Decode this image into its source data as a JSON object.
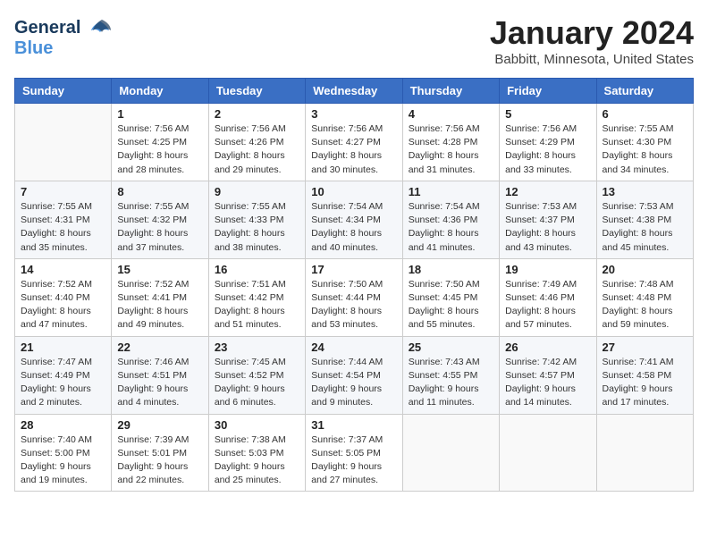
{
  "header": {
    "logo_general": "General",
    "logo_blue": "Blue",
    "month": "January 2024",
    "location": "Babbitt, Minnesota, United States"
  },
  "days_of_week": [
    "Sunday",
    "Monday",
    "Tuesday",
    "Wednesday",
    "Thursday",
    "Friday",
    "Saturday"
  ],
  "weeks": [
    [
      {
        "day": "",
        "sunrise": "",
        "sunset": "",
        "daylight": ""
      },
      {
        "day": "1",
        "sunrise": "Sunrise: 7:56 AM",
        "sunset": "Sunset: 4:25 PM",
        "daylight": "Daylight: 8 hours and 28 minutes."
      },
      {
        "day": "2",
        "sunrise": "Sunrise: 7:56 AM",
        "sunset": "Sunset: 4:26 PM",
        "daylight": "Daylight: 8 hours and 29 minutes."
      },
      {
        "day": "3",
        "sunrise": "Sunrise: 7:56 AM",
        "sunset": "Sunset: 4:27 PM",
        "daylight": "Daylight: 8 hours and 30 minutes."
      },
      {
        "day": "4",
        "sunrise": "Sunrise: 7:56 AM",
        "sunset": "Sunset: 4:28 PM",
        "daylight": "Daylight: 8 hours and 31 minutes."
      },
      {
        "day": "5",
        "sunrise": "Sunrise: 7:56 AM",
        "sunset": "Sunset: 4:29 PM",
        "daylight": "Daylight: 8 hours and 33 minutes."
      },
      {
        "day": "6",
        "sunrise": "Sunrise: 7:55 AM",
        "sunset": "Sunset: 4:30 PM",
        "daylight": "Daylight: 8 hours and 34 minutes."
      }
    ],
    [
      {
        "day": "7",
        "sunrise": "Sunrise: 7:55 AM",
        "sunset": "Sunset: 4:31 PM",
        "daylight": "Daylight: 8 hours and 35 minutes."
      },
      {
        "day": "8",
        "sunrise": "Sunrise: 7:55 AM",
        "sunset": "Sunset: 4:32 PM",
        "daylight": "Daylight: 8 hours and 37 minutes."
      },
      {
        "day": "9",
        "sunrise": "Sunrise: 7:55 AM",
        "sunset": "Sunset: 4:33 PM",
        "daylight": "Daylight: 8 hours and 38 minutes."
      },
      {
        "day": "10",
        "sunrise": "Sunrise: 7:54 AM",
        "sunset": "Sunset: 4:34 PM",
        "daylight": "Daylight: 8 hours and 40 minutes."
      },
      {
        "day": "11",
        "sunrise": "Sunrise: 7:54 AM",
        "sunset": "Sunset: 4:36 PM",
        "daylight": "Daylight: 8 hours and 41 minutes."
      },
      {
        "day": "12",
        "sunrise": "Sunrise: 7:53 AM",
        "sunset": "Sunset: 4:37 PM",
        "daylight": "Daylight: 8 hours and 43 minutes."
      },
      {
        "day": "13",
        "sunrise": "Sunrise: 7:53 AM",
        "sunset": "Sunset: 4:38 PM",
        "daylight": "Daylight: 8 hours and 45 minutes."
      }
    ],
    [
      {
        "day": "14",
        "sunrise": "Sunrise: 7:52 AM",
        "sunset": "Sunset: 4:40 PM",
        "daylight": "Daylight: 8 hours and 47 minutes."
      },
      {
        "day": "15",
        "sunrise": "Sunrise: 7:52 AM",
        "sunset": "Sunset: 4:41 PM",
        "daylight": "Daylight: 8 hours and 49 minutes."
      },
      {
        "day": "16",
        "sunrise": "Sunrise: 7:51 AM",
        "sunset": "Sunset: 4:42 PM",
        "daylight": "Daylight: 8 hours and 51 minutes."
      },
      {
        "day": "17",
        "sunrise": "Sunrise: 7:50 AM",
        "sunset": "Sunset: 4:44 PM",
        "daylight": "Daylight: 8 hours and 53 minutes."
      },
      {
        "day": "18",
        "sunrise": "Sunrise: 7:50 AM",
        "sunset": "Sunset: 4:45 PM",
        "daylight": "Daylight: 8 hours and 55 minutes."
      },
      {
        "day": "19",
        "sunrise": "Sunrise: 7:49 AM",
        "sunset": "Sunset: 4:46 PM",
        "daylight": "Daylight: 8 hours and 57 minutes."
      },
      {
        "day": "20",
        "sunrise": "Sunrise: 7:48 AM",
        "sunset": "Sunset: 4:48 PM",
        "daylight": "Daylight: 8 hours and 59 minutes."
      }
    ],
    [
      {
        "day": "21",
        "sunrise": "Sunrise: 7:47 AM",
        "sunset": "Sunset: 4:49 PM",
        "daylight": "Daylight: 9 hours and 2 minutes."
      },
      {
        "day": "22",
        "sunrise": "Sunrise: 7:46 AM",
        "sunset": "Sunset: 4:51 PM",
        "daylight": "Daylight: 9 hours and 4 minutes."
      },
      {
        "day": "23",
        "sunrise": "Sunrise: 7:45 AM",
        "sunset": "Sunset: 4:52 PM",
        "daylight": "Daylight: 9 hours and 6 minutes."
      },
      {
        "day": "24",
        "sunrise": "Sunrise: 7:44 AM",
        "sunset": "Sunset: 4:54 PM",
        "daylight": "Daylight: 9 hours and 9 minutes."
      },
      {
        "day": "25",
        "sunrise": "Sunrise: 7:43 AM",
        "sunset": "Sunset: 4:55 PM",
        "daylight": "Daylight: 9 hours and 11 minutes."
      },
      {
        "day": "26",
        "sunrise": "Sunrise: 7:42 AM",
        "sunset": "Sunset: 4:57 PM",
        "daylight": "Daylight: 9 hours and 14 minutes."
      },
      {
        "day": "27",
        "sunrise": "Sunrise: 7:41 AM",
        "sunset": "Sunset: 4:58 PM",
        "daylight": "Daylight: 9 hours and 17 minutes."
      }
    ],
    [
      {
        "day": "28",
        "sunrise": "Sunrise: 7:40 AM",
        "sunset": "Sunset: 5:00 PM",
        "daylight": "Daylight: 9 hours and 19 minutes."
      },
      {
        "day": "29",
        "sunrise": "Sunrise: 7:39 AM",
        "sunset": "Sunset: 5:01 PM",
        "daylight": "Daylight: 9 hours and 22 minutes."
      },
      {
        "day": "30",
        "sunrise": "Sunrise: 7:38 AM",
        "sunset": "Sunset: 5:03 PM",
        "daylight": "Daylight: 9 hours and 25 minutes."
      },
      {
        "day": "31",
        "sunrise": "Sunrise: 7:37 AM",
        "sunset": "Sunset: 5:05 PM",
        "daylight": "Daylight: 9 hours and 27 minutes."
      },
      {
        "day": "",
        "sunrise": "",
        "sunset": "",
        "daylight": ""
      },
      {
        "day": "",
        "sunrise": "",
        "sunset": "",
        "daylight": ""
      },
      {
        "day": "",
        "sunrise": "",
        "sunset": "",
        "daylight": ""
      }
    ]
  ]
}
